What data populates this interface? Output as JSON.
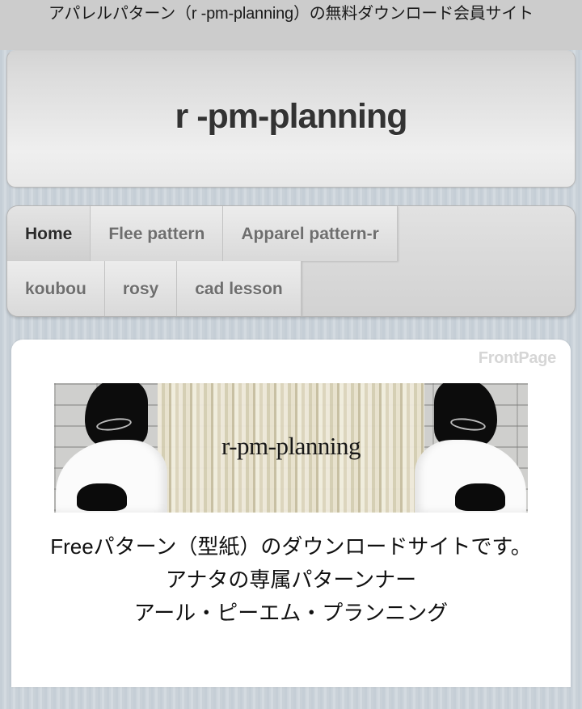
{
  "browser": {
    "page_title": "アパレルパターン（r -pm-planning）の無料ダウンロード会員サイト"
  },
  "header": {
    "site_title": "r -pm-planning"
  },
  "nav": {
    "rows": [
      [
        {
          "label": "Home",
          "active": true
        },
        {
          "label": "Flee pattern",
          "active": false
        },
        {
          "label": "Apparel pattern-r",
          "active": false
        }
      ],
      [
        {
          "label": "koubou",
          "active": false
        },
        {
          "label": "rosy",
          "active": false
        },
        {
          "label": "cad lesson",
          "active": false
        }
      ]
    ]
  },
  "content": {
    "page_label": "FrontPage",
    "banner": {
      "caption": "r-pm-planning",
      "alt": "mirrored black-and-white dress photo with bookshelf background"
    },
    "intro_lines": [
      "Freeパターン（型紙）のダウンロードサイトです。",
      "アナタの専属パターンナー",
      "アール・ピーエム・プランニング"
    ]
  },
  "colors": {
    "wallpaper": "#c7cfd6",
    "title_strip": "#cccccc",
    "card": "#ffffff",
    "page_label": "#d6d6d6",
    "tab_text": "#6e6e6e",
    "tab_text_active": "#2b2b2b"
  }
}
